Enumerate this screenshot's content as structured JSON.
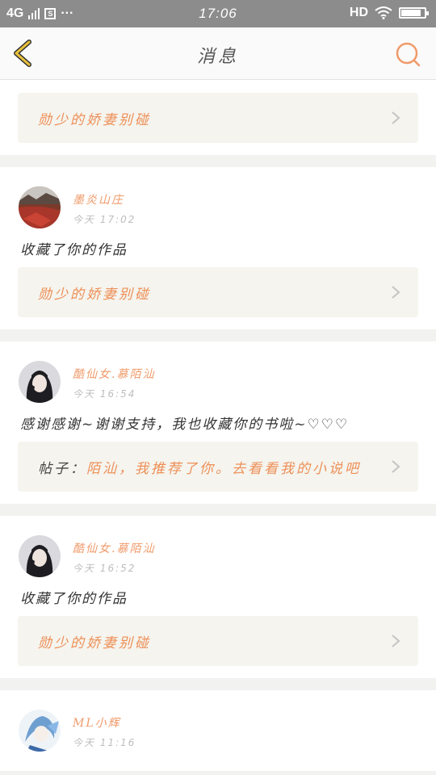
{
  "status_bar": {
    "network": "4G",
    "time": "17:06",
    "hd": "HD",
    "more": "···"
  },
  "nav": {
    "title": "消息"
  },
  "colors": {
    "accent": "#f09a6a",
    "back_arrow": "#e9b83b",
    "link_bg": "#f5f4ee"
  },
  "cards": [
    {
      "link": "勋少的娇妻别碰"
    },
    {
      "avatar": "avatar-landscape",
      "username": "墨炎山庄",
      "time": "今天 17:02",
      "text": "收藏了你的作品",
      "link": "勋少的娇妻别碰"
    },
    {
      "avatar": "avatar-girl",
      "username": "酷仙女.慕陌汕",
      "time": "今天 16:54",
      "text": "感谢感谢~谢谢支持，我也收藏你的书啦~♡♡♡",
      "link_prefix": "帖子：",
      "link": "陌汕，我推荐了你。去看看我的小说吧"
    },
    {
      "avatar": "avatar-girl",
      "username": "酷仙女.慕陌汕",
      "time": "今天 16:52",
      "text": "收藏了你的作品",
      "link": "勋少的娇妻别碰"
    },
    {
      "avatar": "avatar-anime",
      "username": "ML小辉",
      "time": "今天 11:16"
    }
  ]
}
